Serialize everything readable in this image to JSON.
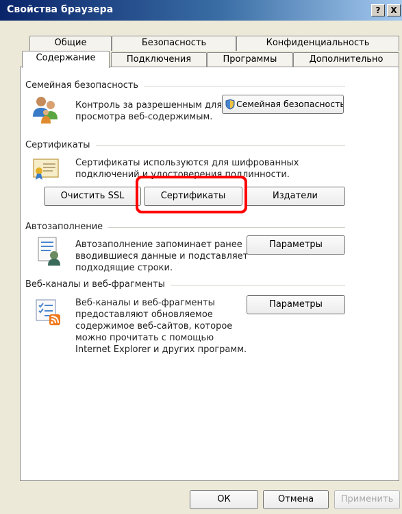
{
  "window": {
    "title": "Свойства браузера",
    "help_label": "?",
    "close_label": "X"
  },
  "tabs": {
    "row1": [
      {
        "label": "Общие"
      },
      {
        "label": "Безопасность"
      },
      {
        "label": "Конфиденциальность"
      }
    ],
    "row2": [
      {
        "label": "Содержание",
        "active": true
      },
      {
        "label": "Подключения"
      },
      {
        "label": "Программы"
      },
      {
        "label": "Дополнительно"
      }
    ]
  },
  "family_safety": {
    "title": "Семейная безопасность",
    "line1": "Контроль за разрешенным для",
    "line2": "просмотра веб-содержимым.",
    "button": "Семейная безопасность"
  },
  "certificates": {
    "title": "Сертификаты",
    "line1": "Сертификаты используются для шифрованных",
    "line2": "подключений и удостоверения подлинности.",
    "clear_ssl": "Очистить SSL",
    "certificates_button": "Сертификаты",
    "publishers": "Издатели"
  },
  "autocomplete": {
    "title": "Автозаполнение",
    "line1": "Автозаполнение запоминает ранее",
    "line2": "вводившиеся данные и подставляет",
    "line3": "подходящие строки.",
    "settings": "Параметры"
  },
  "feeds": {
    "title": "Веб-каналы и веб-фрагменты",
    "line1": "Веб-каналы и веб-фрагменты",
    "line2": "предоставляют обновляемое",
    "line3": "содержимое веб-сайтов, которое",
    "line4": "можно прочитать с помощью",
    "line5": "Internet Explorer и других программ.",
    "settings": "Параметры"
  },
  "footer": {
    "ok": "ОК",
    "cancel": "Отмена",
    "apply": "Применить"
  },
  "colors": {
    "highlight": "#ff0000",
    "titlebar": "#0a246a"
  }
}
